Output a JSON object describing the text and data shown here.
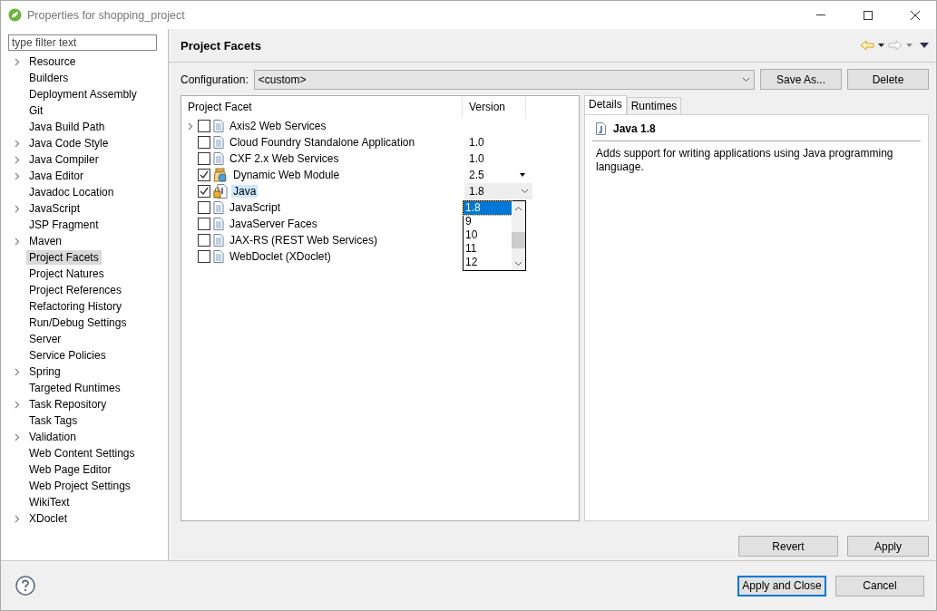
{
  "window": {
    "title": "Properties for shopping_project"
  },
  "filter": {
    "placeholder": "type filter text"
  },
  "sidebar": {
    "items": [
      {
        "label": "Resource",
        "expandable": true,
        "selected": false
      },
      {
        "label": "Builders",
        "expandable": false,
        "selected": false
      },
      {
        "label": "Deployment Assembly",
        "expandable": false,
        "selected": false
      },
      {
        "label": "Git",
        "expandable": false,
        "selected": false
      },
      {
        "label": "Java Build Path",
        "expandable": false,
        "selected": false
      },
      {
        "label": "Java Code Style",
        "expandable": true,
        "selected": false
      },
      {
        "label": "Java Compiler",
        "expandable": true,
        "selected": false
      },
      {
        "label": "Java Editor",
        "expandable": true,
        "selected": false
      },
      {
        "label": "Javadoc Location",
        "expandable": false,
        "selected": false
      },
      {
        "label": "JavaScript",
        "expandable": true,
        "selected": false
      },
      {
        "label": "JSP Fragment",
        "expandable": false,
        "selected": false
      },
      {
        "label": "Maven",
        "expandable": true,
        "selected": false
      },
      {
        "label": "Project Facets",
        "expandable": false,
        "selected": true
      },
      {
        "label": "Project Natures",
        "expandable": false,
        "selected": false
      },
      {
        "label": "Project References",
        "expandable": false,
        "selected": false
      },
      {
        "label": "Refactoring History",
        "expandable": false,
        "selected": false
      },
      {
        "label": "Run/Debug Settings",
        "expandable": false,
        "selected": false
      },
      {
        "label": "Server",
        "expandable": false,
        "selected": false
      },
      {
        "label": "Service Policies",
        "expandable": false,
        "selected": false
      },
      {
        "label": "Spring",
        "expandable": true,
        "selected": false
      },
      {
        "label": "Targeted Runtimes",
        "expandable": false,
        "selected": false
      },
      {
        "label": "Task Repository",
        "expandable": true,
        "selected": false
      },
      {
        "label": "Task Tags",
        "expandable": false,
        "selected": false
      },
      {
        "label": "Validation",
        "expandable": true,
        "selected": false
      },
      {
        "label": "Web Content Settings",
        "expandable": false,
        "selected": false
      },
      {
        "label": "Web Page Editor",
        "expandable": false,
        "selected": false
      },
      {
        "label": "Web Project Settings",
        "expandable": false,
        "selected": false
      },
      {
        "label": "WikiText",
        "expandable": false,
        "selected": false
      },
      {
        "label": "XDoclet",
        "expandable": true,
        "selected": false
      }
    ]
  },
  "page": {
    "title": "Project Facets"
  },
  "configuration": {
    "label": "Configuration:",
    "value": "<custom>",
    "buttons": [
      "Save As...",
      "Delete"
    ]
  },
  "facets": {
    "columns": [
      "Project Facet",
      "Version"
    ],
    "rows": [
      {
        "name": "Axis2 Web Services",
        "kind": "doc",
        "expandable": true,
        "checked": false,
        "selected": false,
        "version": {
          "kind": "none"
        }
      },
      {
        "name": "Cloud Foundry Standalone Application",
        "kind": "doc",
        "expandable": false,
        "checked": false,
        "selected": false,
        "version": {
          "kind": "plain",
          "text": "1.0"
        }
      },
      {
        "name": "CXF 2.x Web Services",
        "kind": "doc",
        "expandable": false,
        "checked": false,
        "selected": false,
        "version": {
          "kind": "plain",
          "text": "1.0"
        }
      },
      {
        "name": "Dynamic Web Module",
        "kind": "module",
        "expandable": false,
        "checked": true,
        "selected": false,
        "version": {
          "kind": "arrow",
          "text": "2.5"
        }
      },
      {
        "name": "Java",
        "kind": "java",
        "expandable": false,
        "checked": true,
        "selected": true,
        "version": {
          "kind": "combo",
          "text": "1.8",
          "options": [
            {
              "label": "1.8",
              "selected": true
            },
            {
              "label": "9",
              "selected": false
            },
            {
              "label": "10",
              "selected": false
            },
            {
              "label": "11",
              "selected": false
            },
            {
              "label": "12",
              "selected": false
            }
          ]
        }
      },
      {
        "name": "JavaScript",
        "kind": "doc",
        "expandable": false,
        "checked": false,
        "selected": false,
        "version": {
          "kind": "none"
        }
      },
      {
        "name": "JavaServer Faces",
        "kind": "doc",
        "expandable": false,
        "checked": false,
        "selected": false,
        "version": {
          "kind": "none"
        }
      },
      {
        "name": "JAX-RS (REST Web Services)",
        "kind": "doc",
        "expandable": false,
        "checked": false,
        "selected": false,
        "version": {
          "kind": "none"
        }
      },
      {
        "name": "WebDoclet (XDoclet)",
        "kind": "doc",
        "expandable": false,
        "checked": false,
        "selected": false,
        "version": {
          "kind": "none"
        }
      }
    ]
  },
  "details": {
    "tabs": [
      {
        "label": "Details",
        "selected": true
      },
      {
        "label": "Runtimes",
        "selected": false
      }
    ],
    "title": "Java 1.8",
    "description": "Adds support for writing applications using Java programming language."
  },
  "page_buttons": [
    "Revert",
    "Apply"
  ],
  "footer_buttons": [
    {
      "label": "Apply and Close",
      "default": true
    },
    {
      "label": "Cancel",
      "default": false
    }
  ]
}
